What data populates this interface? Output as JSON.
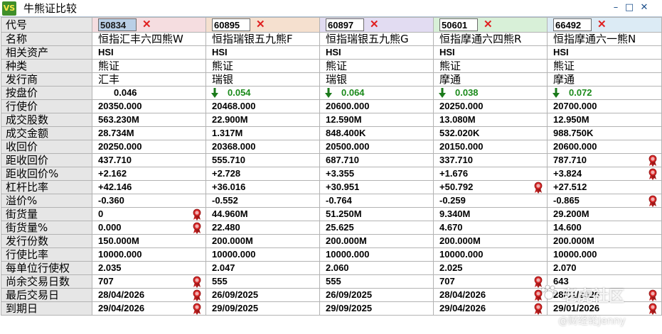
{
  "window": {
    "title": "牛熊证比较",
    "app_icon_text": "VS",
    "minimize": "–",
    "maximize": "□",
    "close": "✕"
  },
  "code_label": "代号",
  "codes": [
    "50834",
    "60895",
    "60897",
    "50601",
    "66492"
  ],
  "header_colors": [
    "#f5dde0",
    "#f5e0cf",
    "#e2dcf2",
    "#d8f0d8",
    "#dcebf5"
  ],
  "remove_icon": "✕",
  "rows": [
    {
      "label": "名称",
      "cn": true,
      "values": [
        "恒指汇丰六四熊W",
        "恒指瑞银五九熊F",
        "恒指瑞银五九熊G",
        "恒指摩通六四熊R",
        "恒指摩通六一熊N"
      ]
    },
    {
      "label": "相关资产",
      "values": [
        "HSI",
        "HSI",
        "HSI",
        "HSI",
        "HSI"
      ]
    },
    {
      "label": "种类",
      "cn": true,
      "values": [
        "熊证",
        "熊证",
        "熊证",
        "熊证",
        "熊证"
      ]
    },
    {
      "label": "发行商",
      "cn": true,
      "values": [
        "汇丰",
        "瑞银",
        "瑞银",
        "摩通",
        "摩通"
      ]
    },
    {
      "label": "按盘价",
      "price": true,
      "values": [
        "0.046",
        "0.054",
        "0.064",
        "0.038",
        "0.072"
      ],
      "down": [
        false,
        true,
        true,
        true,
        true
      ]
    },
    {
      "label": "行使价",
      "values": [
        "20350.000",
        "20468.000",
        "20600.000",
        "20250.000",
        "20700.000"
      ]
    },
    {
      "label": "成交股数",
      "values": [
        "563.230M",
        "22.900M",
        "12.590M",
        "13.080M",
        "12.950M"
      ]
    },
    {
      "label": "成交金额",
      "values": [
        "28.734M",
        "1.317M",
        "848.400K",
        "532.020K",
        "988.750K"
      ]
    },
    {
      "label": "收回价",
      "values": [
        "20250.000",
        "20368.000",
        "20500.000",
        "20150.000",
        "20600.000"
      ]
    },
    {
      "label": "距收回价",
      "values": [
        "437.710",
        "555.710",
        "687.710",
        "337.710",
        "787.710"
      ],
      "medal": [
        false,
        false,
        false,
        false,
        true
      ]
    },
    {
      "label": "距收回价%",
      "values": [
        "+2.162",
        "+2.728",
        "+3.355",
        "+1.676",
        "+3.824"
      ],
      "medal": [
        false,
        false,
        false,
        false,
        true
      ]
    },
    {
      "label": "杠杆比率",
      "values": [
        "+42.146",
        "+36.016",
        "+30.951",
        "+50.792",
        "+27.512"
      ],
      "medal": [
        false,
        false,
        false,
        true,
        false
      ]
    },
    {
      "label": "溢价%",
      "values": [
        "-0.360",
        "-0.552",
        "-0.764",
        "-0.259",
        "-0.865"
      ],
      "medal": [
        false,
        false,
        false,
        false,
        true
      ]
    },
    {
      "label": "街货量",
      "values": [
        "0",
        "44.960M",
        "51.250M",
        "9.340M",
        "29.200M"
      ],
      "medal": [
        true,
        false,
        false,
        false,
        false
      ]
    },
    {
      "label": "街货量%",
      "values": [
        "0.000",
        "22.480",
        "25.625",
        "4.670",
        "14.600"
      ],
      "medal": [
        true,
        false,
        false,
        false,
        false
      ]
    },
    {
      "label": "发行份数",
      "values": [
        "150.000M",
        "200.000M",
        "200.000M",
        "200.000M",
        "200.000M"
      ]
    },
    {
      "label": "行使比率",
      "values": [
        "10000.000",
        "10000.000",
        "10000.000",
        "10000.000",
        "10000.000"
      ]
    },
    {
      "label": "每单位行使权",
      "values": [
        "2.035",
        "2.047",
        "2.060",
        "2.025",
        "2.070"
      ]
    },
    {
      "label": "尚余交易日数",
      "values": [
        "707",
        "555",
        "555",
        "707",
        "643"
      ],
      "medal": [
        true,
        false,
        false,
        true,
        false
      ]
    },
    {
      "label": "最后交易日",
      "values": [
        "28/04/2026",
        "26/09/2025",
        "26/09/2025",
        "28/04/2026",
        "28/01/2026"
      ],
      "medal": [
        true,
        false,
        false,
        true,
        true
      ]
    },
    {
      "label": "到期日",
      "values": [
        "29/04/2026",
        "29/09/2025",
        "29/09/2025",
        "29/04/2026",
        "29/01/2026"
      ],
      "medal": [
        true,
        false,
        false,
        true,
        true
      ]
    }
  ],
  "watermark": {
    "line1": "老虎社区",
    "line2": "@财经轮Jenny"
  }
}
